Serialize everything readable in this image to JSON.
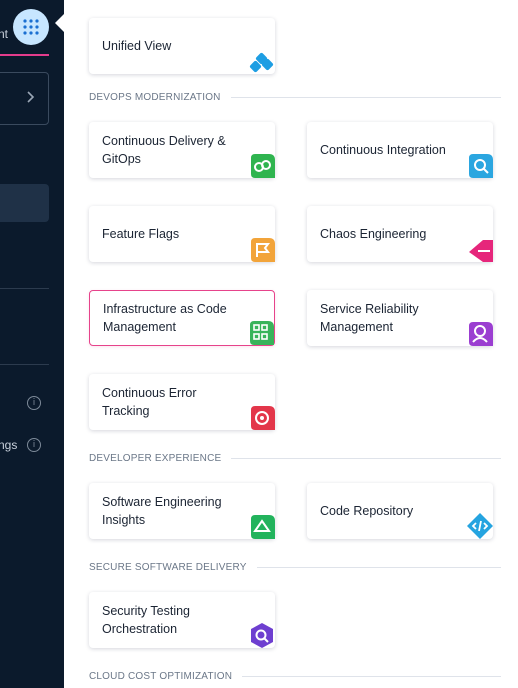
{
  "sidebar": {
    "cut_text_top": "nt",
    "cut_text_1": "",
    "cut_text_2": "ngs",
    "info_glyph": "i"
  },
  "sections": {
    "devops": "DEVOPS MODERNIZATION",
    "developer_experience": "DEVELOPER EXPERIENCE",
    "secure_delivery": "SECURE SOFTWARE DELIVERY",
    "cloud_cost": "CLOUD COST OPTIMIZATION"
  },
  "modules": {
    "unified_view": {
      "label": "Unified View",
      "icon": "unified-view-icon",
      "color": "#1e9ee3"
    },
    "continuous_delivery": {
      "label": "Continuous Delivery & GitOps",
      "icon": "cd-icon",
      "color": "#2fb44f"
    },
    "continuous_integration": {
      "label": "Continuous Integration",
      "icon": "ci-icon",
      "color": "#2ba6e0"
    },
    "feature_flags": {
      "label": "Feature Flags",
      "icon": "feature-flags-icon",
      "color": "#f2a43a"
    },
    "chaos_engineering": {
      "label": "Chaos Engineering",
      "icon": "chaos-icon",
      "color": "#e6267b"
    },
    "iacm": {
      "label": "Infrastructure as Code Management",
      "icon": "iacm-icon",
      "color": "#38b35a"
    },
    "service_reliability": {
      "label": "Service Reliability Management",
      "icon": "srm-icon",
      "color": "#9b3ed1"
    },
    "error_tracking": {
      "label": "Continuous Error Tracking",
      "icon": "error-tracking-icon",
      "color": "#e3364a"
    },
    "sei": {
      "label": "Software Engineering Insights",
      "icon": "sei-icon",
      "color": "#22b35c"
    },
    "code_repository": {
      "label": "Code Repository",
      "icon": "code-repo-icon",
      "color": "#25a4e0"
    },
    "sto": {
      "label": "Security Testing Orchestration",
      "icon": "sto-icon",
      "color": "#6e3fd0"
    }
  }
}
